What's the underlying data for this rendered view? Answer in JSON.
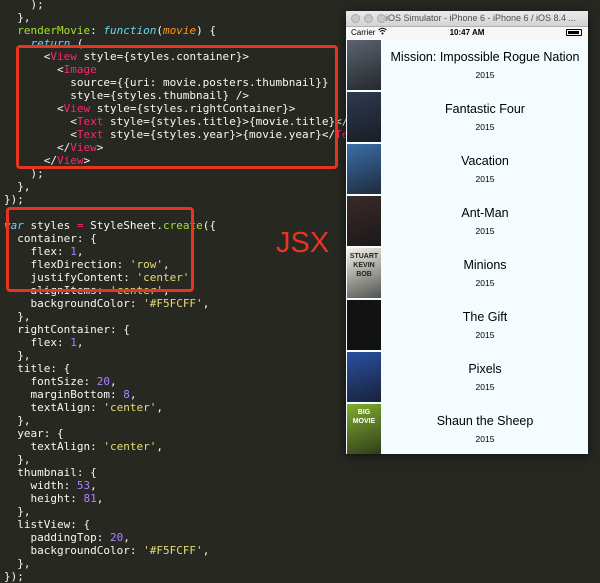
{
  "editor": {
    "lines": [
      "    );",
      "  },",
      "  renderMovie: function(movie) {",
      "    return (",
      "      <View style={styles.container}>",
      "        <Image",
      "          source={{uri: movie.posters.thumbnail}}",
      "          style={styles.thumbnail} />",
      "        <View style={styles.rightContainer}>",
      "          <Text style={styles.title}>{movie.title}</Text>",
      "          <Text style={styles.year}>{movie.year}</Text>",
      "        </View>",
      "      </View>",
      "    );",
      "  },",
      "});",
      "",
      "var styles = StyleSheet.create({",
      "  container: {",
      "    flex: 1,",
      "    flexDirection: 'row',",
      "    justifyContent: 'center',",
      "    alignItems: 'center',",
      "    backgroundColor: '#F5FCFF',",
      "  },",
      "  rightContainer: {",
      "    flex: 1,",
      "  },",
      "  title: {",
      "    fontSize: 20,",
      "    marginBottom: 8,",
      "    textAlign: 'center',",
      "  },",
      "  year: {",
      "    textAlign: 'center',",
      "  },",
      "  thumbnail: {",
      "    width: 53,",
      "    height: 81,",
      "  },",
      "  listView: {",
      "    paddingTop: 20,",
      "    backgroundColor: '#F5FCFF',",
      "  },",
      "});"
    ],
    "annotation_label": "JSX",
    "colors": {
      "background": "#272822",
      "highlight": "#e8351f",
      "keyword": "#66d9ef",
      "tag": "#f92672",
      "function": "#a6e22e",
      "number": "#ae81ff",
      "string": "#e6db74"
    }
  },
  "simulator": {
    "window_title": "iOS Simulator - iPhone 6 - iPhone 6 / iOS 8.4 ...",
    "status": {
      "carrier": "Carrier",
      "time": "10:47 AM"
    },
    "movies": [
      {
        "title": "Mission: Impossible Rogue Nation",
        "year": "2015",
        "poster_text": "",
        "poster_color": "#5a6470"
      },
      {
        "title": "Fantastic Four",
        "year": "2015",
        "poster_text": "",
        "poster_color": "#2f3a52"
      },
      {
        "title": "Vacation",
        "year": "2015",
        "poster_text": "",
        "poster_color": "#3c6ea8"
      },
      {
        "title": "Ant-Man",
        "year": "2015",
        "poster_text": "",
        "poster_color": "#3a2a2a"
      },
      {
        "title": "Minions",
        "year": "2015",
        "poster_text": "STUART KEVIN BOB",
        "poster_color": "#f4f4ea"
      },
      {
        "title": "The Gift",
        "year": "2015",
        "poster_text": "",
        "poster_color": "#121212"
      },
      {
        "title": "Pixels",
        "year": "2015",
        "poster_text": "",
        "poster_color": "#2a4fa0"
      },
      {
        "title": "Shaun the Sheep",
        "year": "2015",
        "poster_text": "BIG MOVIE",
        "poster_color": "#7fae2e"
      }
    ]
  }
}
